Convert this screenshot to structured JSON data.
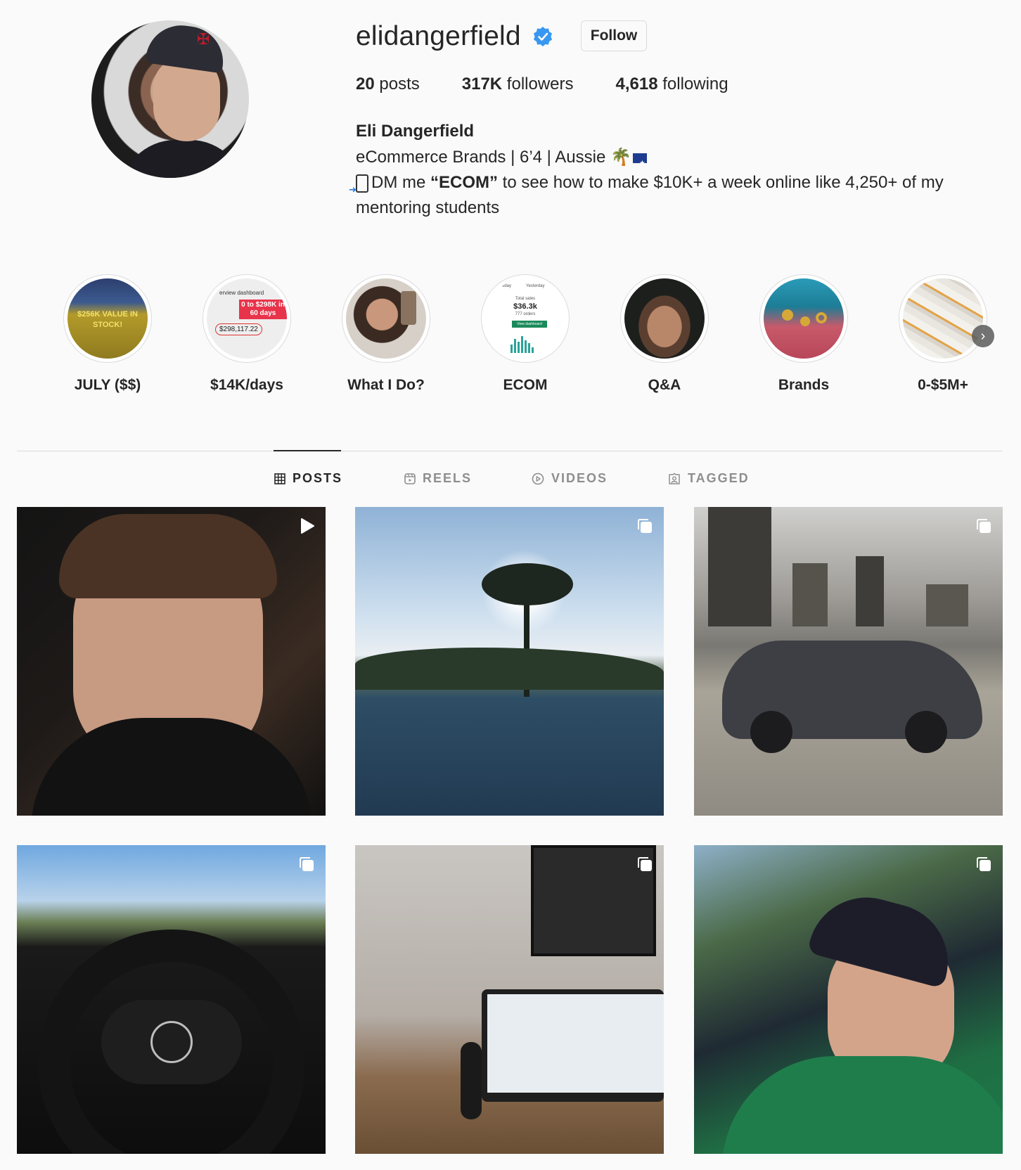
{
  "profile": {
    "username": "elidangerfield",
    "follow_label": "Follow",
    "stats": {
      "posts_count": "20",
      "posts_label": "posts",
      "followers_count": "317K",
      "followers_label": "followers",
      "following_count": "4,618",
      "following_label": "following"
    },
    "display_name": "Eli Dangerfield",
    "bio_line1": "eCommerce Brands | 6’4 | Aussie",
    "bio_line2_pre": "DM me ",
    "bio_line2_bold": "“ECOM”",
    "bio_line2_post": " to see how to make $10K+ a week online like 4,250+ of my mentoring students"
  },
  "highlights": [
    {
      "label": "JULY ($$)",
      "text": "$256K VALUE IN STOCK!"
    },
    {
      "label": "$14K/days",
      "text": "0 to $298K in 60 days",
      "sub": "$298,117.22",
      "caption": "erview dashboard"
    },
    {
      "label": "What I Do?"
    },
    {
      "label": "ECOM",
      "sub_label": "Total sales",
      "value": "$36.3k",
      "orders": "777 orders",
      "button": "View dashboard",
      "tab1": "oday",
      "tab2": "Yesterday"
    },
    {
      "label": "Q&A"
    },
    {
      "label": "Brands"
    },
    {
      "label": "0-$5M+"
    }
  ],
  "tabs": [
    {
      "label": "POSTS",
      "icon": "grid-icon",
      "active": true
    },
    {
      "label": "REELS",
      "icon": "reels-icon",
      "active": false
    },
    {
      "label": "VIDEOS",
      "icon": "play-icon",
      "active": false
    },
    {
      "label": "TAGGED",
      "icon": "tag-icon",
      "active": false
    }
  ],
  "colors": {
    "verified": "#3897f0",
    "text": "#262626",
    "muted": "#8e8e8e",
    "border": "#dbdbdb",
    "background": "#fafafa"
  }
}
